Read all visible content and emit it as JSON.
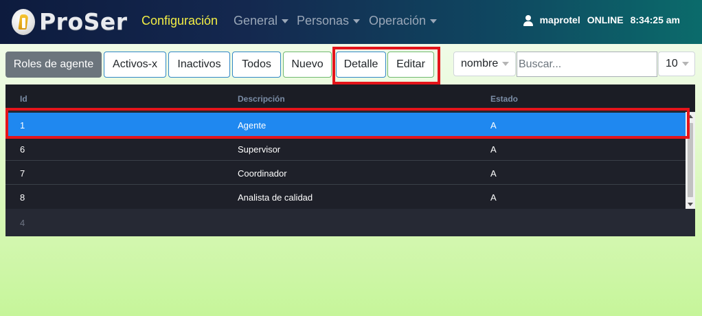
{
  "navbar": {
    "brand": "ProSer",
    "items": [
      {
        "label": "Configuración",
        "active": true
      },
      {
        "label": "General",
        "dropdown": true
      },
      {
        "label": "Personas",
        "dropdown": true
      },
      {
        "label": "Operación",
        "dropdown": true
      }
    ],
    "user": "maprotel",
    "status": "ONLINE",
    "time": "8:34:25 am",
    "user_icon": "user-icon"
  },
  "toolbar": {
    "title_button": "Roles de agente",
    "buttons": [
      "Activos-x",
      "Inactivos",
      "Todos",
      "Nuevo",
      "Detalle",
      "Editar"
    ],
    "search_field": "nombre",
    "search_placeholder": "Buscar...",
    "page_size": "10"
  },
  "table": {
    "columns": [
      "Id",
      "Descripción",
      "Estado"
    ],
    "rows": [
      {
        "id": "1",
        "descripcion": "Agente",
        "estado": "A",
        "selected": true
      },
      {
        "id": "6",
        "descripcion": "Supervisor",
        "estado": "A"
      },
      {
        "id": "7",
        "descripcion": "Coordinador",
        "estado": "A"
      },
      {
        "id": "8",
        "descripcion": "Analista de calidad",
        "estado": "A"
      }
    ],
    "footer_count": "4"
  },
  "colors": {
    "selected_row": "#1f88f0",
    "highlight": "#e4141b",
    "active_nav": "#f3ee45"
  }
}
